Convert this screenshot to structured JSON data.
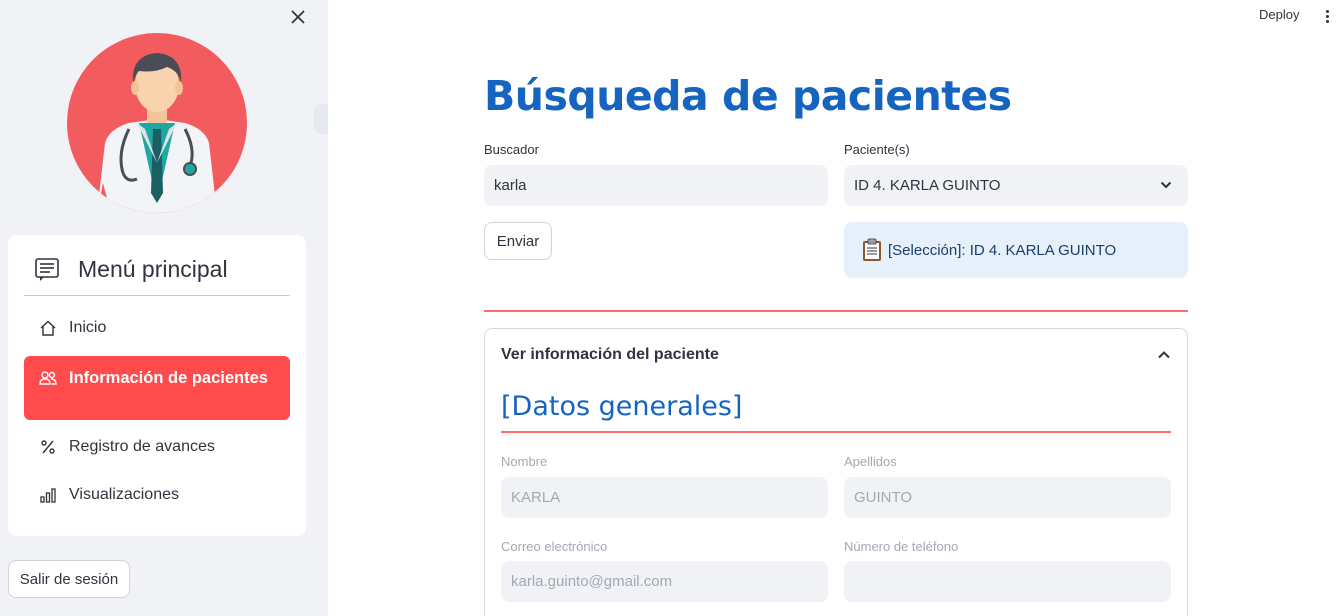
{
  "sidebar": {
    "close_icon": "close-icon",
    "avatar_icon": "doctor-avatar",
    "menu": {
      "title": "Menú principal",
      "title_icon": "menu-list-icon",
      "items": [
        {
          "label": "Inicio",
          "icon": "house-icon",
          "active": false
        },
        {
          "label": "Información de pacientes",
          "icon": "people-icon",
          "active": true
        },
        {
          "label": "Registro de avances",
          "icon": "percent-icon",
          "active": false
        },
        {
          "label": "Visualizaciones",
          "icon": "bar-chart-icon",
          "active": false
        }
      ]
    },
    "logout_label": "Salir de sesión"
  },
  "topbar": {
    "deploy_label": "Deploy",
    "menu_icon": "kebab-menu-icon"
  },
  "main": {
    "title": "Búsqueda de pacientes",
    "search": {
      "label": "Buscador",
      "value": "karla"
    },
    "patients_select": {
      "label": "Paciente(s)",
      "value": "ID 4. KARLA GUINTO"
    },
    "send_label": "Enviar",
    "selection_info": {
      "icon": "clipboard-icon",
      "text": "[Selección]: ID 4. KARLA GUINTO"
    },
    "expander": {
      "title": "Ver información del paciente",
      "expanded": true,
      "section_title": "[Datos generales]",
      "fields": {
        "nombre": {
          "label": "Nombre",
          "value": "KARLA"
        },
        "apellidos": {
          "label": "Apellidos",
          "value": "GUINTO"
        },
        "correo": {
          "label": "Correo electrónico",
          "value": "karla.guinto@gmail.com"
        },
        "telefono": {
          "label": "Número de teléfono",
          "value": ""
        }
      }
    }
  },
  "colors": {
    "accent": "#ff4b4b",
    "title_blue": "#1565c0",
    "sidebar_bg": "#f0f2f6",
    "info_bg": "#e6f0fb"
  }
}
